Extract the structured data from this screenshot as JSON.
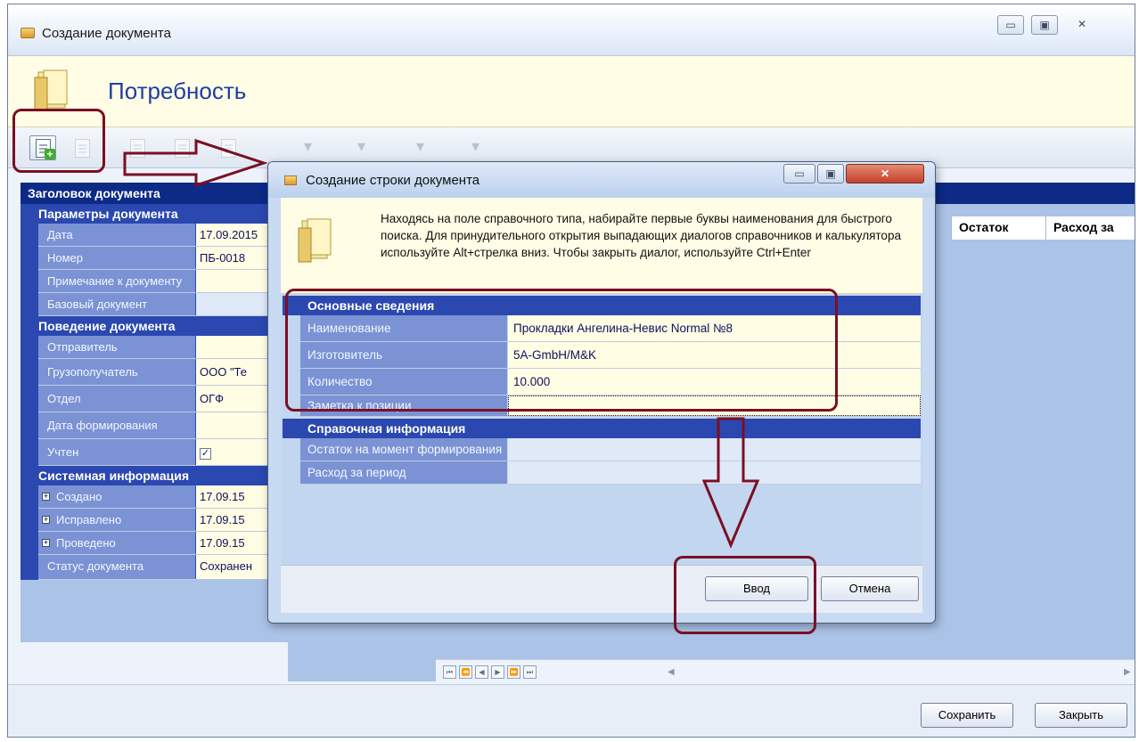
{
  "main_window": {
    "title": "Создание документа",
    "controls": {
      "minimize": "▭",
      "maximize": "▣",
      "close": "✕"
    },
    "header_title": "Потребность"
  },
  "toolbar": {
    "buttons": [
      {
        "name": "new-row",
        "active": true
      },
      {
        "name": "copy-row",
        "active": false
      },
      {
        "name": "edit-row",
        "active": false
      },
      {
        "name": "doc-a",
        "active": false
      },
      {
        "name": "doc-b",
        "active": false
      }
    ],
    "dropdown_glyph": "▾"
  },
  "left_panel": {
    "header": "Заголовок документа",
    "sections": [
      {
        "title": "Параметры документа",
        "rows": [
          {
            "label": "Дата",
            "value": "17.09.2015"
          },
          {
            "label": "Номер",
            "value": "ПБ-0018"
          },
          {
            "label": "Примечание к документу",
            "value": ""
          },
          {
            "label": "Базовый документ",
            "value": ""
          }
        ]
      },
      {
        "title": "Поведение документа",
        "rows": [
          {
            "label": "Отправитель",
            "value": ""
          },
          {
            "label": "Грузополучатель",
            "value": "ООО \"Те"
          },
          {
            "label": "Отдел",
            "value": "ОГФ"
          },
          {
            "label": "Дата формирования",
            "value": ""
          },
          {
            "label": "Учтен",
            "value": ""
          }
        ]
      },
      {
        "title": "Системная информация",
        "rows": [
          {
            "label": "Создано",
            "value": "17.09.15"
          },
          {
            "label": "Исправлено",
            "value": "17.09.15"
          },
          {
            "label": "Проведено",
            "value": "17.09.15"
          },
          {
            "label": "Статус документа",
            "value": "Сохранен"
          }
        ]
      }
    ],
    "checkbox_mark": "✓",
    "expand_mark": "+"
  },
  "grid": {
    "columns": [
      "Остаток",
      "Расход за"
    ]
  },
  "footer_buttons": {
    "save": "Сохранить",
    "close": "Закрыть"
  },
  "dialog": {
    "title": "Создание строки документа",
    "hint": "Находясь на поле справочного типа, набирайте первые буквы наименования для быстрого поиска. Для принудительного открытия выпадающих диалогов справочников и калькулятора используйте Alt+стрелка вниз. Чтобы закрыть диалог, используйте Ctrl+Enter",
    "sections": [
      {
        "title": "Основные сведения",
        "rows": [
          {
            "label": "Наименование",
            "value": "Прокладки Ангелина-Невис Normal №8"
          },
          {
            "label": "Изготовитель",
            "value": "5A-GmbH/M&K"
          },
          {
            "label": "Количество",
            "value": "10.000"
          },
          {
            "label": "Заметка к позиции",
            "value": ""
          }
        ]
      },
      {
        "title": "Справочная информация",
        "rows": [
          {
            "label": "Остаток на момент формирования",
            "value": ""
          },
          {
            "label": "Расход за период",
            "value": ""
          }
        ]
      }
    ],
    "buttons": {
      "ok": "Ввод",
      "cancel": "Отмена"
    }
  },
  "colors": {
    "section_blue": "#2b48b0",
    "label_blue": "#7b93d4",
    "value_yellow": "#fffde3",
    "header_navy": "#0c2a86",
    "annotation": "#7a0f24"
  }
}
